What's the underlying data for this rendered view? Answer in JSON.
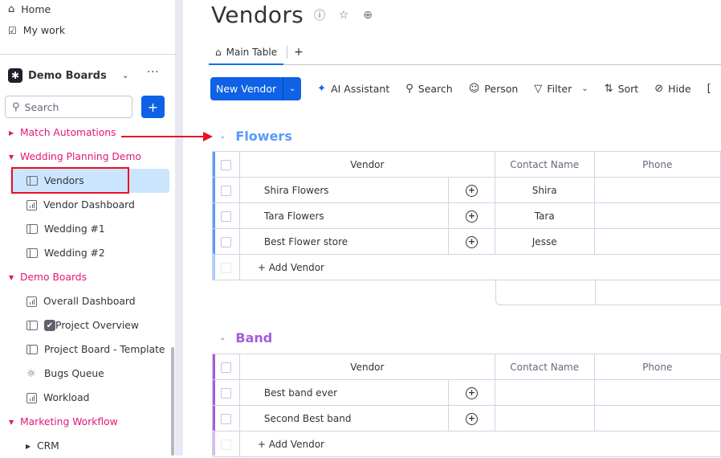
{
  "sidebar": {
    "home": "Home",
    "my_work": "My work",
    "workspace": {
      "title": "Demo Boards"
    },
    "search_placeholder": "Search",
    "add_label": "+",
    "folders": [
      {
        "label": "Match Automations",
        "expanded": false,
        "items": []
      },
      {
        "label": "Wedding Planning Demo",
        "expanded": true,
        "items": [
          {
            "label": "Vendors",
            "icon": "board-icon",
            "active": true
          },
          {
            "label": "Vendor Dashboard",
            "icon": "dashboard-icon"
          },
          {
            "label": "Wedding #1",
            "icon": "board-icon"
          },
          {
            "label": "Wedding #2",
            "icon": "board-icon"
          }
        ]
      },
      {
        "label": "Demo Boards",
        "expanded": true,
        "items": [
          {
            "label": "Overall Dashboard",
            "icon": "dashboard-icon"
          },
          {
            "label": "Project Overview",
            "icon": "board-icon"
          },
          {
            "label": "Project Board - Template",
            "icon": "board-icon"
          },
          {
            "label": "Bugs Queue",
            "icon": "bug-icon"
          },
          {
            "label": "Workload",
            "icon": "dashboard-icon"
          }
        ]
      },
      {
        "label": "Marketing Workflow",
        "expanded": true,
        "items": [
          {
            "label": "CRM",
            "icon": "caret-right-icon"
          }
        ]
      }
    ]
  },
  "header": {
    "title": "Vendors",
    "tabs": [
      {
        "label": "Main Table"
      }
    ],
    "add_tab": "+"
  },
  "toolbar": {
    "new_item": "New Vendor",
    "ai_assistant": "AI Assistant",
    "search": "Search",
    "person": "Person",
    "filter": "Filter",
    "sort": "Sort",
    "hide": "Hide"
  },
  "colors": {
    "accent": "#0f62e6",
    "folder": "#e2157b",
    "flowers_group": "#579bfc",
    "band_group": "#a25ddc",
    "annotation": "#e81123"
  },
  "groups": [
    {
      "title": "Flowers",
      "columns": [
        "Vendor",
        "Contact Name",
        "Phone"
      ],
      "rows": [
        {
          "vendor": "Shira Flowers",
          "contact": "Shira",
          "phone": ""
        },
        {
          "vendor": "Tara Flowers",
          "contact": "Tara",
          "phone": ""
        },
        {
          "vendor": "Best Flower store",
          "contact": "Jesse",
          "phone": ""
        }
      ],
      "add_label": "+ Add Vendor"
    },
    {
      "title": "Band",
      "columns": [
        "Vendor",
        "Contact Name",
        "Phone"
      ],
      "rows": [
        {
          "vendor": "Best band ever",
          "contact": "",
          "phone": ""
        },
        {
          "vendor": "Second Best band",
          "contact": "",
          "phone": ""
        }
      ],
      "add_label": "+ Add Vendor"
    }
  ]
}
